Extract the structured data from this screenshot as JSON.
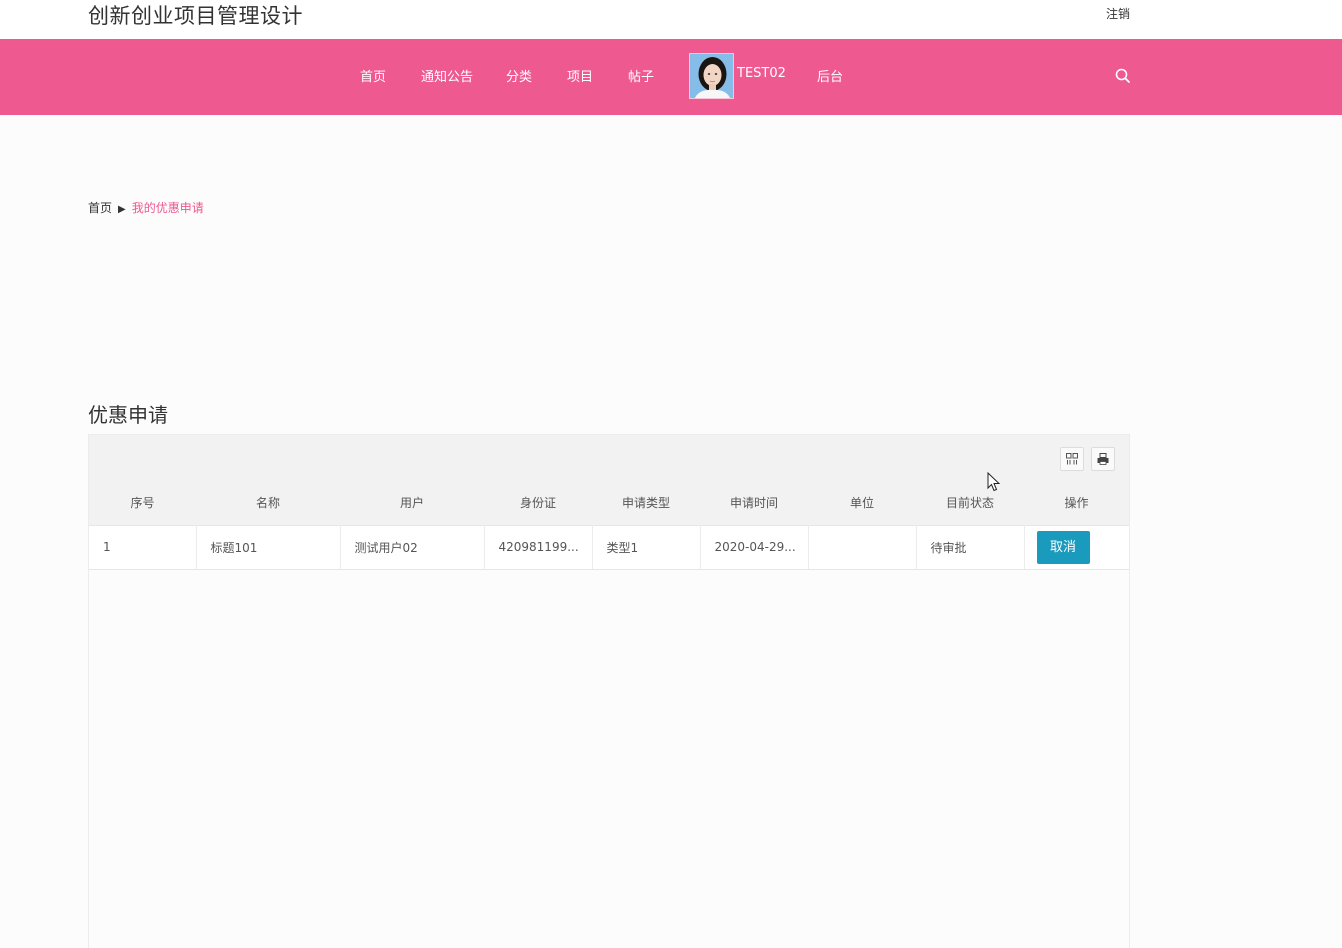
{
  "header": {
    "site_title": "创新创业项目管理设计",
    "logout_label": "注销"
  },
  "nav": {
    "items": [
      "首页",
      "通知公告",
      "分类",
      "项目",
      "帖子"
    ],
    "username": "TEST02",
    "admin_label": "后台",
    "brand_color": "#ee5990"
  },
  "breadcrumb": {
    "home": "首页",
    "separator": "▶",
    "current": "我的优惠申请"
  },
  "section": {
    "title": "优惠申请"
  },
  "table": {
    "columns": [
      "序号",
      "名称",
      "用户",
      "身份证",
      "申请类型",
      "申请时间",
      "单位",
      "目前状态",
      "操作"
    ],
    "rows": [
      {
        "index": "1",
        "name": "标题101",
        "user": "测试用户02",
        "id_card": "420981199...",
        "type": "类型1",
        "time": "2020-04-29...",
        "unit": "",
        "status": "待审批",
        "action": "取消"
      }
    ],
    "toolbar_icons": [
      "columns-icon",
      "print-icon"
    ]
  }
}
